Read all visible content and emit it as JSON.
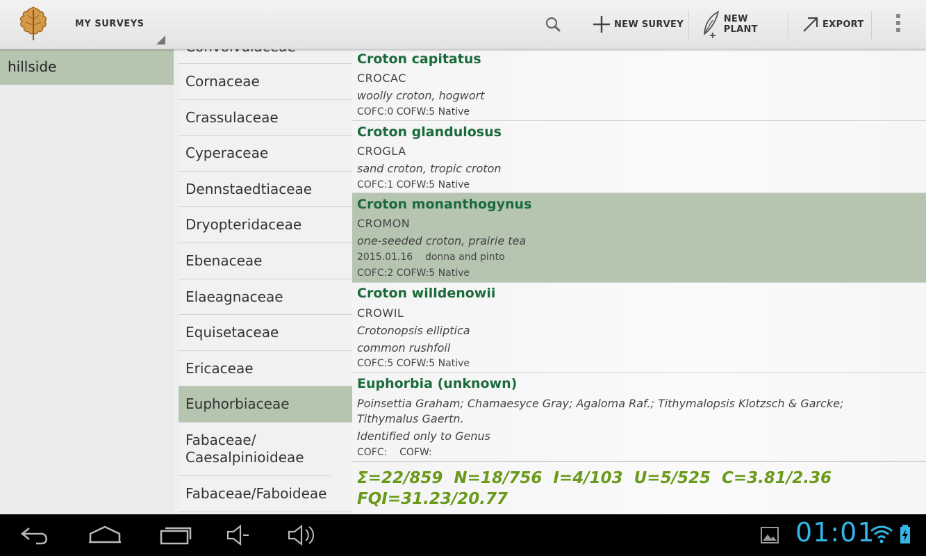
{
  "actionbar": {
    "survey_spinner": "MY SURVEYS",
    "new_survey": "NEW SURVEY",
    "new_plant": "NEW PLANT",
    "export": "EXPORT"
  },
  "surveys": [
    {
      "name": "hillside",
      "selected": true
    }
  ],
  "families": [
    {
      "name": "Convolvulaceae",
      "partial": true
    },
    {
      "name": "Cornaceae"
    },
    {
      "name": "Crassulaceae"
    },
    {
      "name": "Cyperaceae"
    },
    {
      "name": "Dennstaedtiaceae"
    },
    {
      "name": "Dryopteridaceae"
    },
    {
      "name": "Ebenaceae"
    },
    {
      "name": "Elaeagnaceae"
    },
    {
      "name": "Equisetaceae"
    },
    {
      "name": "Ericaceae"
    },
    {
      "name": "Euphorbiaceae",
      "selected": true
    },
    {
      "name": "Fabaceae/ Caesalpinioideae"
    },
    {
      "name": "Fabaceae/Faboideae"
    }
  ],
  "plants": [
    {
      "name": "Croton capitatus",
      "code": "CROCAC",
      "common": "woolly croton, hogwort",
      "meta": "COFC:0  COFW:5  Native"
    },
    {
      "name": "Croton glandulosus",
      "code": "CROGLA",
      "common": "sand croton, tropic croton",
      "meta": "COFC:1  COFW:5  Native"
    },
    {
      "name": "Croton monanthogynus",
      "code": "CROMON",
      "common": "one-seeded croton, prairie tea",
      "observed": "2015.01.16    donna and pinto",
      "meta": "COFC:2  COFW:5  Native",
      "selected": true
    },
    {
      "name": "Croton willdenowii",
      "code": "CROWIL",
      "synonym": "Crotonopsis elliptica",
      "common": "common rushfoil",
      "meta": "COFC:5  COFW:5  Native"
    },
    {
      "name": "Euphorbia (unknown)",
      "synonym": "Poinsettia Graham; Chamaesyce Gray; Agaloma Raf.; Tithymalopsis Klotzsch & Garcke; Tithymalus Gaertn.",
      "common": "Identified only to Genus",
      "meta": "COFC:    COFW:"
    }
  ],
  "stats": {
    "line1": "Σ=22/859  N=18/756  I=4/103  U=5/525  C=3.81/2.36",
    "line2": "FQI=31.23/20.77"
  },
  "systembar": {
    "clock": "01:01"
  },
  "colors": {
    "selection": "#b6c5b0",
    "plant_name": "#1a6a3a",
    "stats": "#6a9a1a",
    "clock": "#33b5e5"
  }
}
